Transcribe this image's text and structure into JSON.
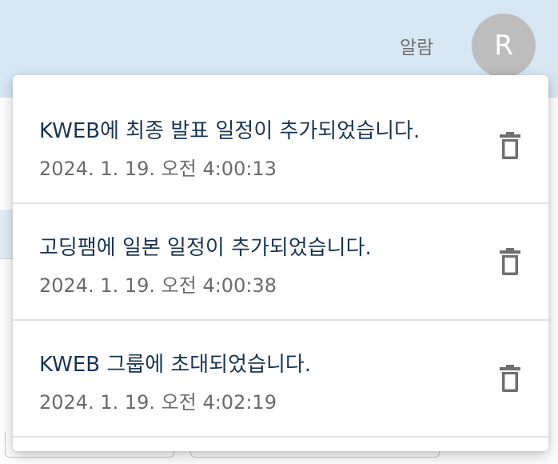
{
  "header": {
    "label": "알람",
    "avatar_initial": "R"
  },
  "notifications": [
    {
      "message": "KWEB에 최종 발표 일정이 추가되었습니다.",
      "timestamp": "2024. 1. 19. 오전 4:00:13",
      "icon": "trash-icon"
    },
    {
      "message": "고딩팸에 일본 일정이 추가되었습니다.",
      "timestamp": "2024. 1. 19. 오전 4:00:38",
      "icon": "trash-icon"
    },
    {
      "message": "KWEB 그룹에 초대되었습니다.",
      "timestamp": "2024. 1. 19. 오전 4:02:19",
      "icon": "trash-icon"
    }
  ],
  "colors": {
    "header_bg": "#d7e7f4",
    "message_text": "#1a3552",
    "timestamp_text": "#6b6b6b",
    "icon": "#6f6f6f",
    "avatar_bg": "#bdbdbd"
  }
}
